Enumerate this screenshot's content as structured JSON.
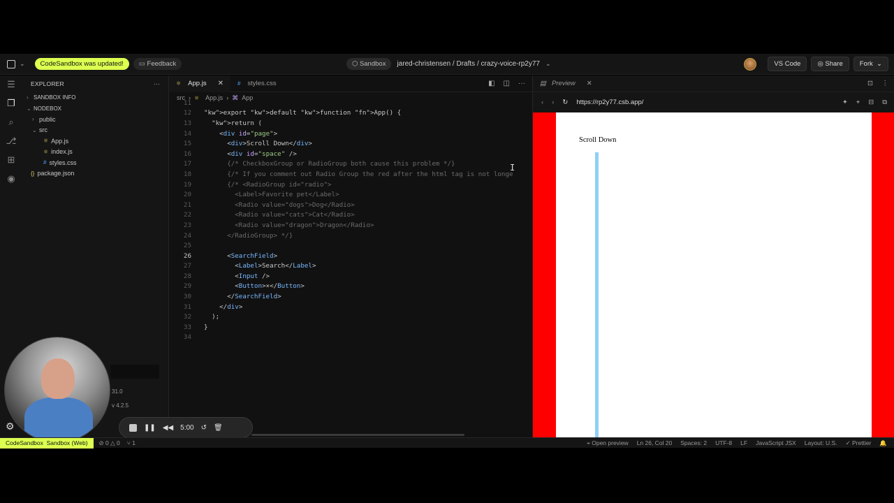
{
  "topbar": {
    "update_pill": "CodeSandbox was updated!",
    "feedback": "Feedback",
    "sandbox": "Sandbox",
    "path": "jared-christensen / Drafts / crazy-voice-rp2y77",
    "vscode": "VS Code",
    "share": "Share",
    "fork": "Fork"
  },
  "explorer": {
    "title": "EXPLORER",
    "section_info": "SANDBOX INFO",
    "section_nodebox": "NODEBOX",
    "items": [
      "public",
      "src",
      "App.js",
      "index.js",
      "styles.css",
      "package.json"
    ]
  },
  "editor": {
    "tabs": [
      "App.js",
      "styles.css"
    ],
    "breadcrumb": [
      "src",
      "App.js",
      "App"
    ],
    "lines": [
      {
        "n": "11",
        "t": ""
      },
      {
        "n": "12",
        "t": "export default function App() {"
      },
      {
        "n": "13",
        "t": "  return ("
      },
      {
        "n": "14",
        "t": "    <div id=\"page\">"
      },
      {
        "n": "15",
        "t": "      <div>Scroll Down</div>"
      },
      {
        "n": "16",
        "t": "      <div id=\"space\" />"
      },
      {
        "n": "17",
        "t": "      {/* CheckboxGroup or RadioGroup both cause this problem */}"
      },
      {
        "n": "18",
        "t": "      {/* If you comment out Radio Group the red after the html tag is not longe"
      },
      {
        "n": "19",
        "t": "      {/* <RadioGroup id=\"radio\">"
      },
      {
        "n": "20",
        "t": "        <Label>Favorite pet</Label>"
      },
      {
        "n": "21",
        "t": "        <Radio value=\"dogs\">Dog</Radio>"
      },
      {
        "n": "22",
        "t": "        <Radio value=\"cats\">Cat</Radio>"
      },
      {
        "n": "23",
        "t": "        <Radio value=\"dragon\">Dragon</Radio>"
      },
      {
        "n": "24",
        "t": "      </RadioGroup> */}"
      },
      {
        "n": "25",
        "t": ""
      },
      {
        "n": "26",
        "t": "      <SearchField>"
      },
      {
        "n": "27",
        "t": "        <Label>Search</Label>"
      },
      {
        "n": "28",
        "t": "        <Input />"
      },
      {
        "n": "29",
        "t": "        <Button>×</Button>"
      },
      {
        "n": "30",
        "t": "      </SearchField>"
      },
      {
        "n": "31",
        "t": "    </div>"
      },
      {
        "n": "32",
        "t": "  );"
      },
      {
        "n": "33",
        "t": "}"
      },
      {
        "n": "34",
        "t": ""
      }
    ]
  },
  "preview": {
    "tab": "Preview",
    "url": "https://rp2y77.csb.app/",
    "page_text": "Scroll Down"
  },
  "statusbar": {
    "codesandbox": "CodeSandbox",
    "sandbox_web": "Sandbox (Web)",
    "errors": "0",
    "warnings": "0",
    "ports": "1",
    "open_preview": "Open preview",
    "position": "Ln 26, Col 20",
    "spaces": "Spaces: 2",
    "encoding": "UTF-8",
    "eol": "LF",
    "language": "JavaScript JSX",
    "layout": "Layout: U.S.",
    "prettier": "Prettier"
  },
  "overlay": {
    "timer": "5:00",
    "version1": "31.0",
    "version2": "4.2.5"
  }
}
